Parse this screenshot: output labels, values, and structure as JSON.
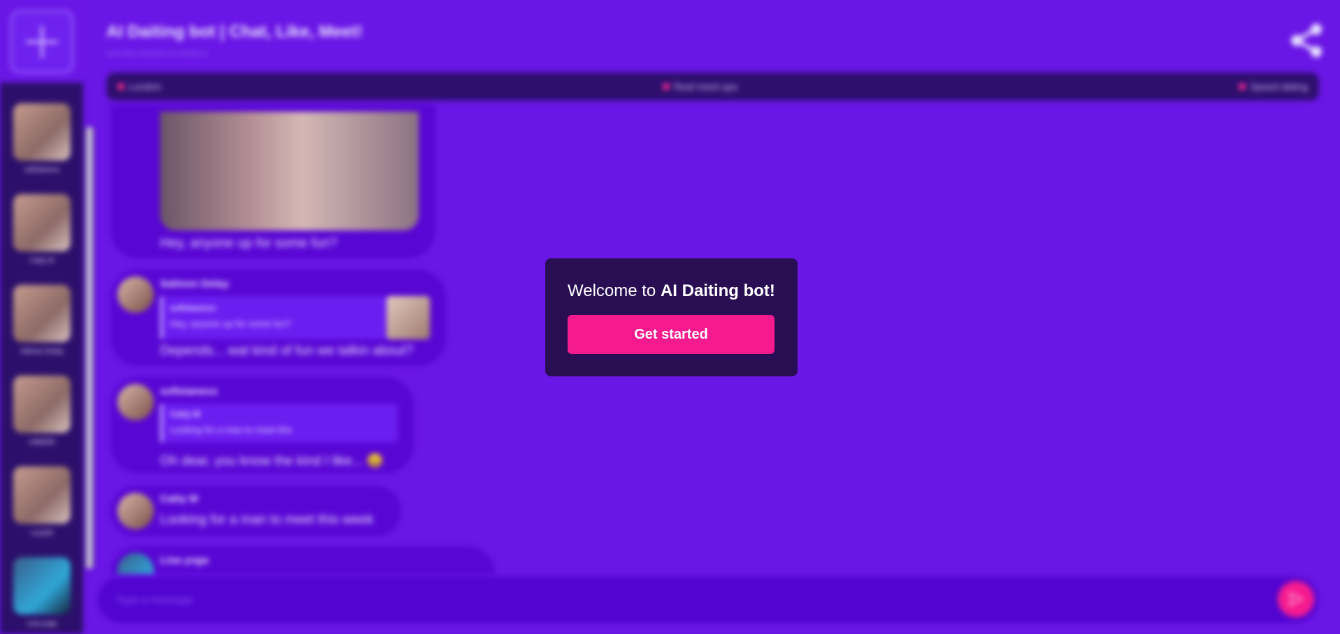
{
  "header": {
    "title": "AI Daiting bot | Chat, Like, Meet!",
    "subtitle": "DATING ROOM 00 000012"
  },
  "tags": [
    {
      "label": "London"
    },
    {
      "label": "Real meet-ups"
    },
    {
      "label": "Speed dating"
    }
  ],
  "sidebar": {
    "add_icon": "plus-icon",
    "users": [
      {
        "name": "sofietanexx"
      },
      {
        "name": "Catty M"
      },
      {
        "name": "Salmon Delay"
      },
      {
        "name": "milla000"
      },
      {
        "name": "Lexy00"
      },
      {
        "name": "Lisa yoga"
      }
    ]
  },
  "messages": [
    {
      "text": "Hey, anyone up for some fun?"
    },
    {
      "author": "Salmon Delay",
      "quote_author": "sofietanexx",
      "quote_text": "Hey, anyone up for some fun?",
      "text": "Depends... wat kind of fun we talkin about?"
    },
    {
      "author": "sofietanexx",
      "quote_author": "Catty M",
      "quote_text": "Looking for a man to meet this",
      "text": "Oh dear, you know the kind I like... 😄"
    },
    {
      "author": "Catty M",
      "text": "Looking for a man to meet this week"
    },
    {
      "author": "Lisa yoga"
    }
  ],
  "composer": {
    "placeholder": "Type a message",
    "send_icon": "send-icon"
  },
  "modal": {
    "prefix": "Welcome to ",
    "brand": "AI Daiting bot!",
    "button_label": "Get started"
  },
  "colors": {
    "background": "#6a16e6",
    "sidebar": "#2c0f6b",
    "bubble": "#5806d4",
    "accent": "#f51b8f",
    "modal": "#2a0e54"
  }
}
